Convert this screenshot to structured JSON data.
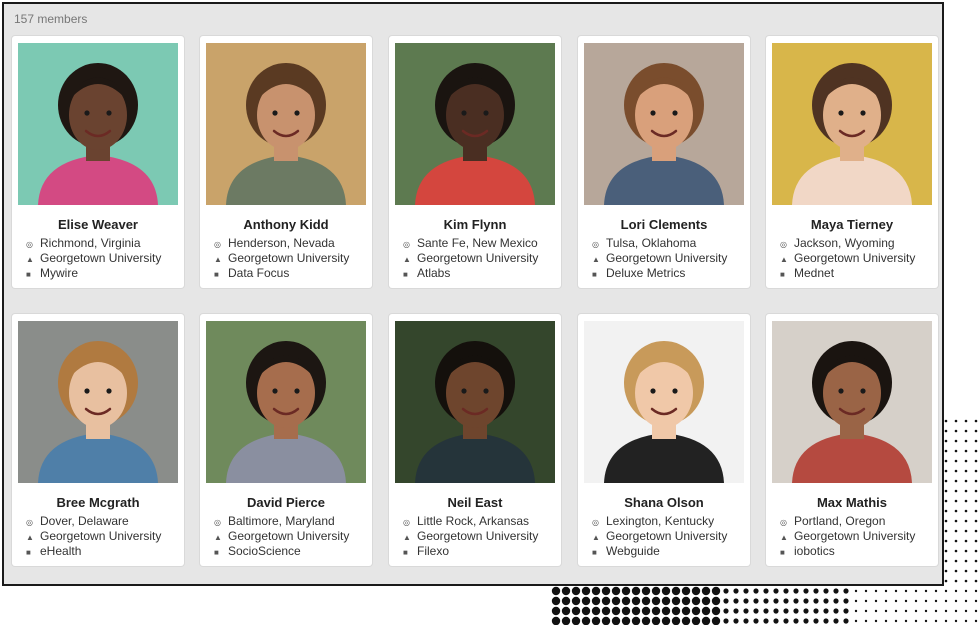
{
  "members_count": "157 members",
  "members": [
    {
      "name": "Elise Weaver",
      "location": "Richmond, Virginia",
      "school": "Georgetown University",
      "company": "Mywire",
      "photo": {
        "bg": "#7cc9b3",
        "skin": "#6a4330",
        "hair": "#1f1712",
        "shirt": "#d34a83"
      }
    },
    {
      "name": "Anthony Kidd",
      "location": "Henderson, Nevada",
      "school": "Georgetown University",
      "company": "Data Focus",
      "photo": {
        "bg": "#c9a36a",
        "skin": "#c8926e",
        "hair": "#5a3a22",
        "shirt": "#6c7a63"
      }
    },
    {
      "name": "Kim Flynn",
      "location": "Sante Fe, New Mexico",
      "school": "Georgetown University",
      "company": "Atlabs",
      "photo": {
        "bg": "#5d7a50",
        "skin": "#4a2e22",
        "hair": "#1a1410",
        "shirt": "#d4463e"
      }
    },
    {
      "name": "Lori Clements",
      "location": "Tulsa, Oklahoma",
      "school": "Georgetown University",
      "company": "Deluxe Metrics",
      "photo": {
        "bg": "#b7a79a",
        "skin": "#d9a07b",
        "hair": "#7a4d2d",
        "shirt": "#4a5f7a"
      }
    },
    {
      "name": "Maya Tierney",
      "location": "Jackson, Wyoming",
      "school": "Georgetown University",
      "company": "Mednet",
      "photo": {
        "bg": "#d8b64a",
        "skin": "#e0b08a",
        "hair": "#4f3322",
        "shirt": "#f1d7c6"
      }
    },
    {
      "name": "Bree Mcgrath",
      "location": "Dover, Delaware",
      "school": "Georgetown University",
      "company": "eHealth",
      "photo": {
        "bg": "#8a8d8a",
        "skin": "#e8c0a0",
        "hair": "#b07a40",
        "shirt": "#4f7fa8"
      }
    },
    {
      "name": "David Pierce",
      "location": "Baltimore, Maryland",
      "school": "Georgetown University",
      "company": "SocioScience",
      "photo": {
        "bg": "#6f8a5c",
        "skin": "#a66d4d",
        "hair": "#1c1612",
        "shirt": "#8a8fa0"
      }
    },
    {
      "name": "Neil East",
      "location": "Little Rock, Arkansas",
      "school": "Georgetown University",
      "company": "Filexo",
      "photo": {
        "bg": "#34462c",
        "skin": "#6e452d",
        "hair": "#14100c",
        "shirt": "#25343a"
      }
    },
    {
      "name": "Shana Olson",
      "location": "Lexington, Kentucky",
      "school": "Georgetown University",
      "company": "Webguide",
      "photo": {
        "bg": "#f2f2f2",
        "skin": "#f0c8a8",
        "hair": "#c89a5a",
        "shirt": "#222222"
      }
    },
    {
      "name": "Max Mathis",
      "location": "Portland, Oregon",
      "school": "Georgetown University",
      "company": "iobotics",
      "photo": {
        "bg": "#d6d0c9",
        "skin": "#9a6446",
        "hair": "#1a1410",
        "shirt": "#b54a40"
      }
    }
  ],
  "icons": {
    "location": "map-pin-icon",
    "school": "university-icon",
    "company": "briefcase-icon"
  }
}
